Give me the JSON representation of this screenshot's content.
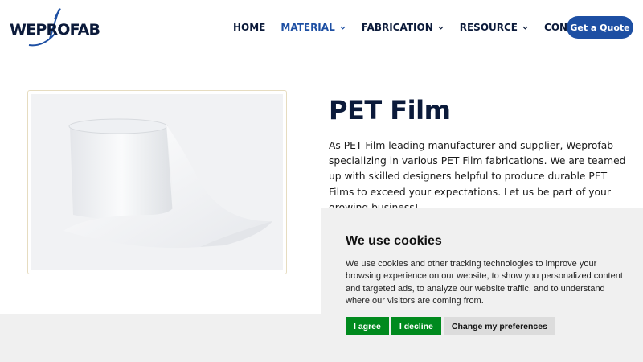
{
  "header": {
    "logo_text": "WEPROFAB",
    "nav": [
      {
        "label": "HOME",
        "active": false,
        "dropdown": false
      },
      {
        "label": "MATERIAL",
        "active": true,
        "dropdown": true
      },
      {
        "label": "FABRICATION",
        "active": false,
        "dropdown": true
      },
      {
        "label": "RESOURCE",
        "active": false,
        "dropdown": true
      },
      {
        "label": "CONTACT US",
        "active": false,
        "dropdown": false
      }
    ],
    "cta_label": "Get a Quote"
  },
  "main": {
    "title": "PET Film",
    "description": "As PET Film leading manufacturer and supplier, Weprofab specializing in various PET Film fabrications. We are teamed up with skilled designers helpful to produce durable PET Films to exceed your expectations. Let us be part of your growing business!"
  },
  "cookie": {
    "title": "We use cookies",
    "text": "We use cookies and other tracking technologies to improve your browsing experience on our website, to show you personalized content and targeted ads, to analyze our website traffic, and to understand where our visitors are coming from.",
    "agree_label": "I agree",
    "decline_label": "I decline",
    "prefs_label": "Change my preferences"
  },
  "colors": {
    "brand_navy": "#0b1a3a",
    "brand_blue": "#1d4fa3",
    "agree_green": "#008a1e"
  }
}
